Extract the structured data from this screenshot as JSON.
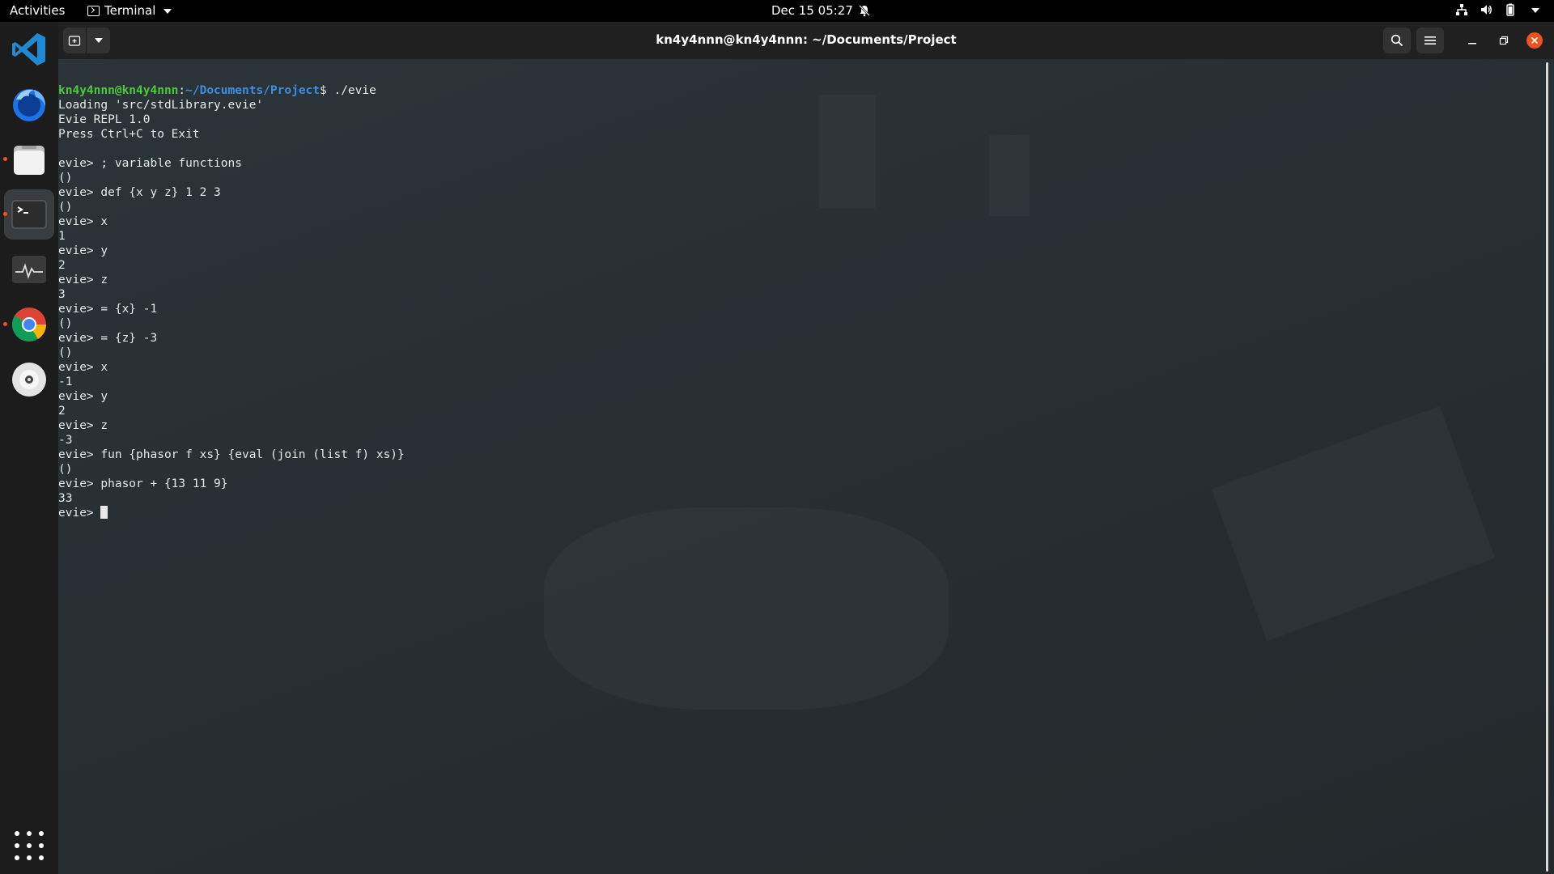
{
  "topbar": {
    "activities": "Activities",
    "app_menu_label": "Terminal",
    "clock": "Dec 15  05:27"
  },
  "dock": {
    "items": [
      {
        "name": "Visual Studio Code",
        "icon": "vscode-icon"
      },
      {
        "name": "Firefox",
        "icon": "firefox-icon"
      },
      {
        "name": "Files",
        "icon": "files-icon"
      },
      {
        "name": "Terminal",
        "icon": "terminal-icon"
      },
      {
        "name": "System Monitor",
        "icon": "system-monitor-icon"
      },
      {
        "name": "Google Chrome",
        "icon": "chrome-icon"
      },
      {
        "name": "Disc",
        "icon": "disc-icon"
      }
    ]
  },
  "window": {
    "title": "kn4y4nnn@kn4y4nnn: ~/Documents/Project"
  },
  "terminal": {
    "prompt_user": "kn4y4nnn@kn4y4nnn",
    "prompt_colon": ":",
    "prompt_path": "~/Documents/Project",
    "prompt_cmd": "$ ./evie",
    "lines": [
      "Loading 'src/stdLibrary.evie'",
      "Evie REPL 1.0",
      "Press Ctrl+C to Exit",
      "",
      "evie> ; variable functions",
      "()",
      "evie> def {x y z} 1 2 3",
      "()",
      "evie> x",
      "1",
      "evie> y",
      "2",
      "evie> z",
      "3",
      "evie> = {x} -1",
      "()",
      "evie> = {z} -3",
      "()",
      "evie> x",
      "-1",
      "evie> y",
      "2",
      "evie> z",
      "-3",
      "evie> fun {phasor f xs} {eval (join (list f) xs)}",
      "()",
      "evie> phasor + {13 11 9}",
      "33"
    ],
    "last_prompt": "evie> "
  }
}
